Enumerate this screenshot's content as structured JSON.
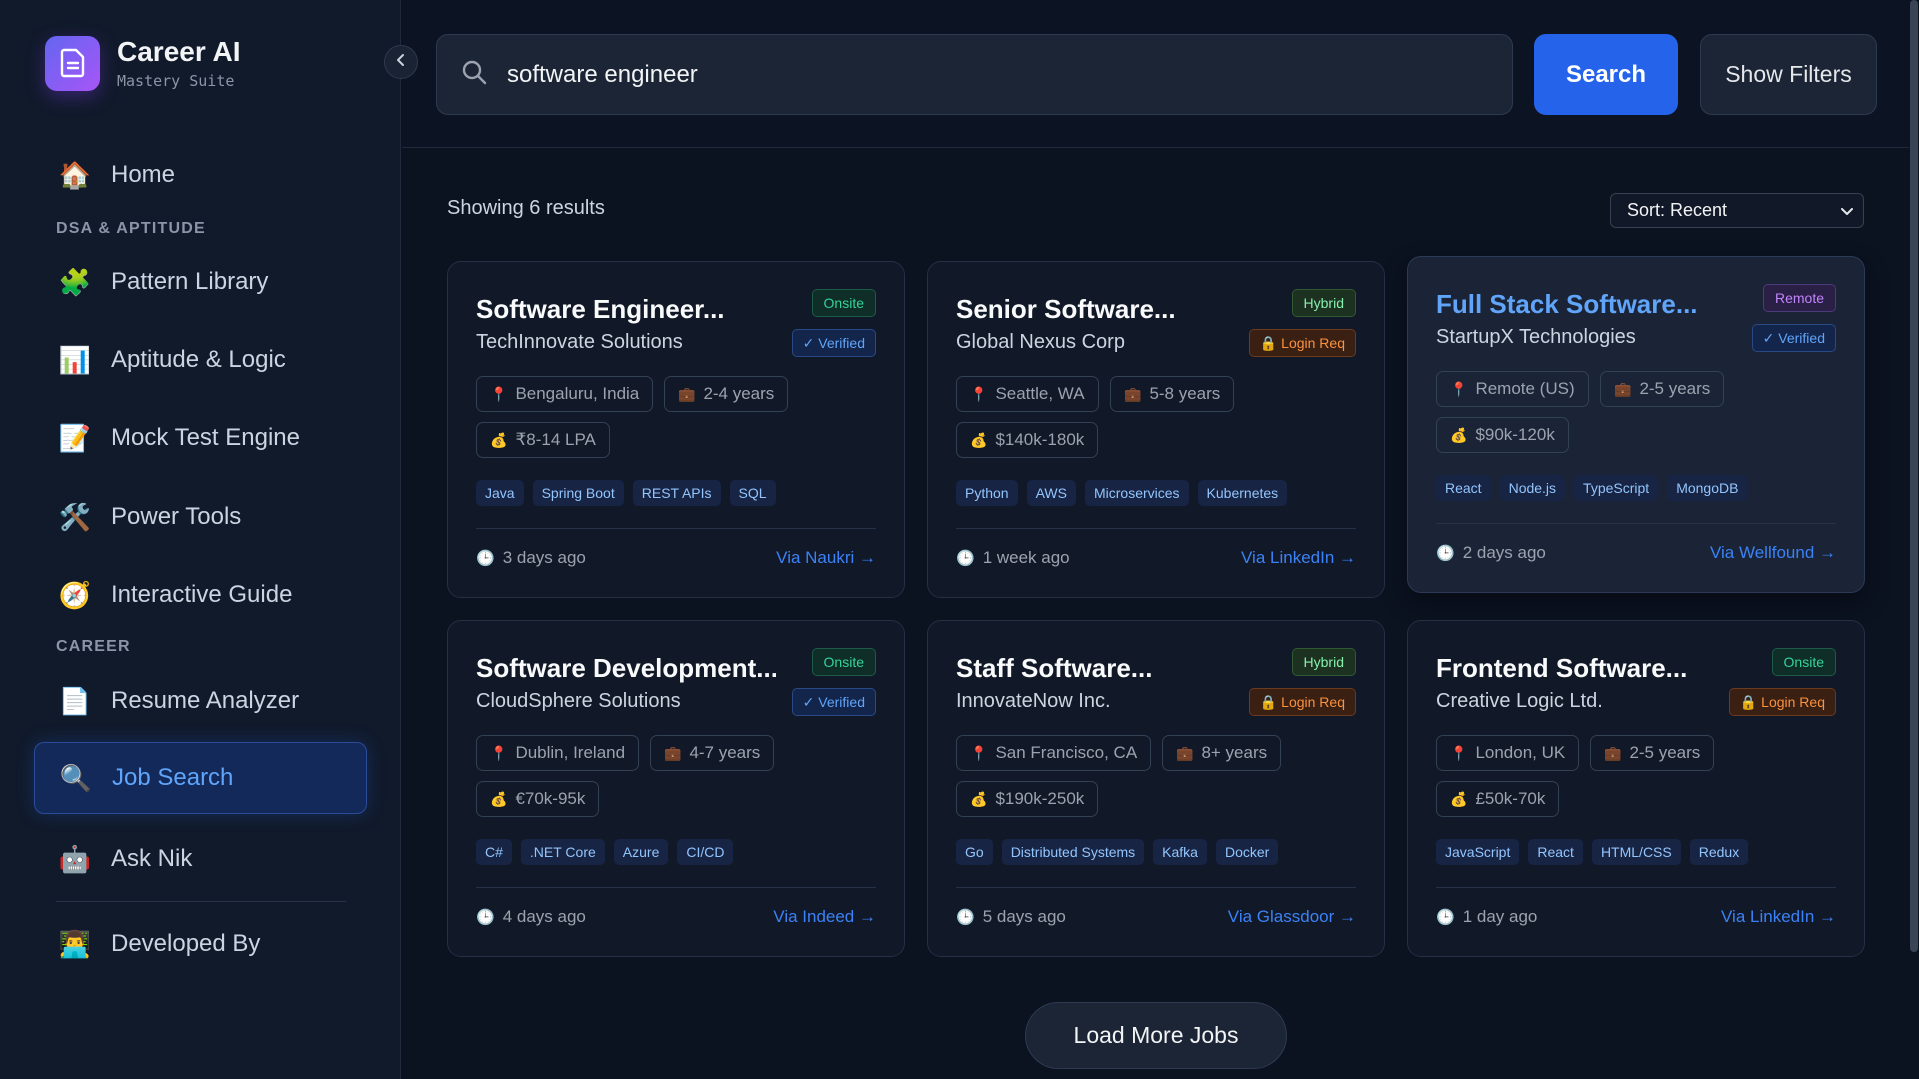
{
  "brand": {
    "title": "Career AI",
    "subtitle": "Mastery Suite"
  },
  "sidebar": {
    "items": [
      {
        "label": "Home",
        "icon": "🏠"
      },
      {
        "section": "DSA & APTITUDE"
      },
      {
        "label": "Pattern Library",
        "icon": "🧩"
      },
      {
        "label": "Aptitude & Logic",
        "icon": "📊"
      },
      {
        "label": "Mock Test Engine",
        "icon": "📝"
      },
      {
        "label": "Power Tools",
        "icon": "🛠️"
      },
      {
        "label": "Interactive Guide",
        "icon": "🧭"
      },
      {
        "section": "CAREER"
      },
      {
        "label": "Resume Analyzer",
        "icon": "📄"
      },
      {
        "label": "Job Search",
        "icon": "🔍",
        "active": true
      },
      {
        "label": "Ask Nik",
        "icon": "🤖"
      },
      {
        "label": "Developed By",
        "icon": "👨‍💻"
      }
    ]
  },
  "search": {
    "value": "software engineer",
    "button": "Search",
    "filters_button": "Show Filters"
  },
  "results": {
    "count_text": "Showing 6 results",
    "sort": "Sort: Recent"
  },
  "jobs": [
    {
      "title": "Software Engineer...",
      "company": "TechInnovate Solutions",
      "type": "Onsite",
      "status": "✓ Verified",
      "location": "Bengaluru, India",
      "experience": "2-4 years",
      "salary": "₹8-14 LPA",
      "tags": [
        "Java",
        "Spring Boot",
        "REST APIs",
        "SQL"
      ],
      "posted": "3 days ago",
      "source": "Via Naukri →"
    },
    {
      "title": "Senior Software...",
      "company": "Global Nexus Corp",
      "type": "Hybrid",
      "status": "🔒 Login Req",
      "location": "Seattle, WA",
      "experience": "5-8 years",
      "salary": "$140k-180k",
      "tags": [
        "Python",
        "AWS",
        "Microservices",
        "Kubernetes"
      ],
      "posted": "1 week ago",
      "source": "Via LinkedIn →"
    },
    {
      "title": "Full Stack Software...",
      "company": "StartupX Technologies",
      "type": "Remote",
      "status": "✓ Verified",
      "location": "Remote (US)",
      "experience": "2-5 years",
      "salary": "$90k-120k",
      "tags": [
        "React",
        "Node.js",
        "TypeScript",
        "MongoDB"
      ],
      "posted": "2 days ago",
      "source": "Via Wellfound →"
    },
    {
      "title": "Software Development...",
      "company": "CloudSphere Solutions",
      "type": "Onsite",
      "status": "✓ Verified",
      "location": "Dublin, Ireland",
      "experience": "4-7 years",
      "salary": "€70k-95k",
      "tags": [
        "C#",
        ".NET Core",
        "Azure",
        "CI/CD"
      ],
      "posted": "4 days ago",
      "source": "Via Indeed →"
    },
    {
      "title": "Staff Software...",
      "company": "InnovateNow Inc.",
      "type": "Hybrid",
      "status": "🔒 Login Req",
      "location": "San Francisco, CA",
      "experience": "8+ years",
      "salary": "$190k-250k",
      "tags": [
        "Go",
        "Distributed Systems",
        "Kafka",
        "Docker"
      ],
      "posted": "5 days ago",
      "source": "Via Glassdoor →"
    },
    {
      "title": "Frontend Software...",
      "company": "Creative Logic Ltd.",
      "type": "Onsite",
      "status": "🔒 Login Req",
      "location": "London, UK",
      "experience": "2-5 years",
      "salary": "£50k-70k",
      "tags": [
        "JavaScript",
        "React",
        "HTML/CSS",
        "Redux"
      ],
      "posted": "1 day ago",
      "source": "Via LinkedIn →"
    }
  ],
  "load_more": "Load More Jobs",
  "colors": {
    "accent": "#2563eb",
    "background": "#0b1220",
    "sidebar": "#111a2b"
  }
}
